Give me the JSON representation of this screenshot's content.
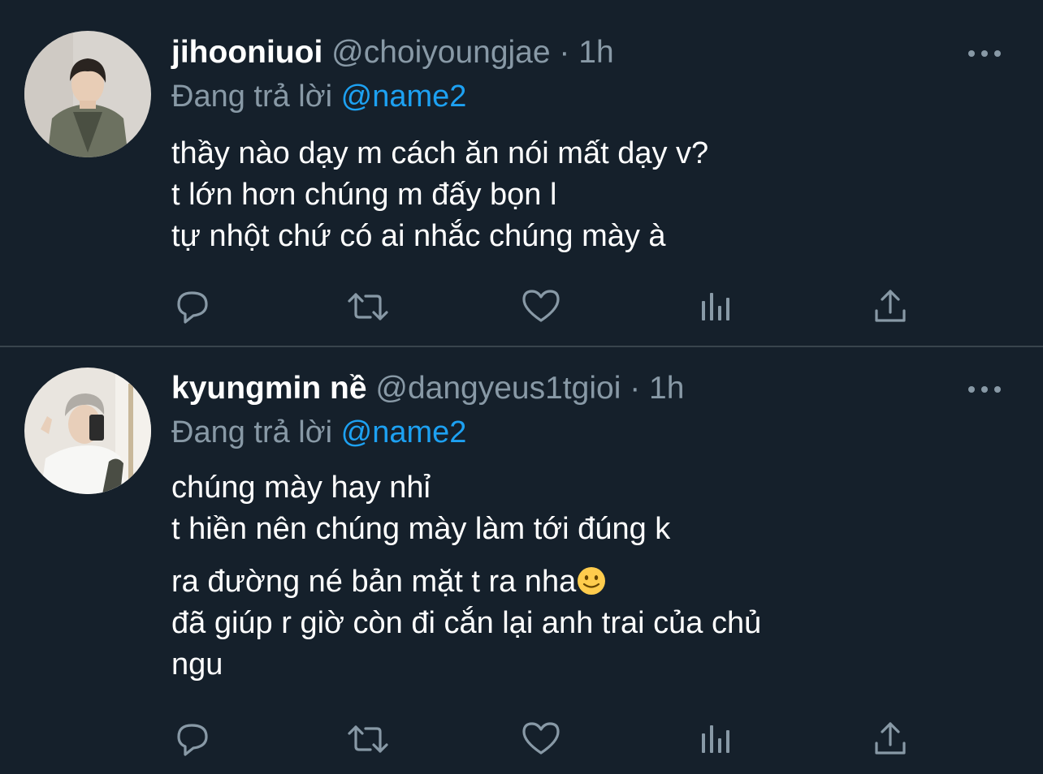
{
  "colors": {
    "background": "#15202b",
    "text_primary": "#ffffff",
    "text_secondary": "#8899a6",
    "link": "#1da1f2",
    "separator": "#38444d"
  },
  "tweets": [
    {
      "display_name": "jihooniuoi",
      "handle": "@choiyoungjae",
      "separator": "·",
      "time": "1h",
      "reply_prefix": "Đang trả lời",
      "reply_to": "@name2",
      "body_paragraphs": [
        [
          "thầy nào dạy m cách ăn nói mất dạy v?",
          "t lớn hơn chúng m đấy bọn l",
          "tự nhột chứ có ai nhắc chúng mày à"
        ]
      ],
      "actions": [
        "reply-icon",
        "retweet-icon",
        "like-icon",
        "stats-icon",
        "share-icon"
      ],
      "more_icon": "more-icon"
    },
    {
      "display_name": "kyungmin nề",
      "handle": "@dangyeus1tgioi",
      "separator": "·",
      "time": "1h",
      "reply_prefix": "Đang trả lời",
      "reply_to": "@name2",
      "body_paragraphs": [
        [
          "chúng mày hay nhỉ",
          "t hiền nên chúng mày làm tới đúng k"
        ],
        [
          "ra đường né bản mặt t ra nha",
          "đã giúp r giờ còn đi cắn lại anh trai của chủ",
          "ngu"
        ]
      ],
      "emoji": "slightly-smiling-face-icon",
      "actions": [
        "reply-icon",
        "retweet-icon",
        "like-icon",
        "stats-icon",
        "share-icon"
      ],
      "more_icon": "more-icon"
    }
  ]
}
